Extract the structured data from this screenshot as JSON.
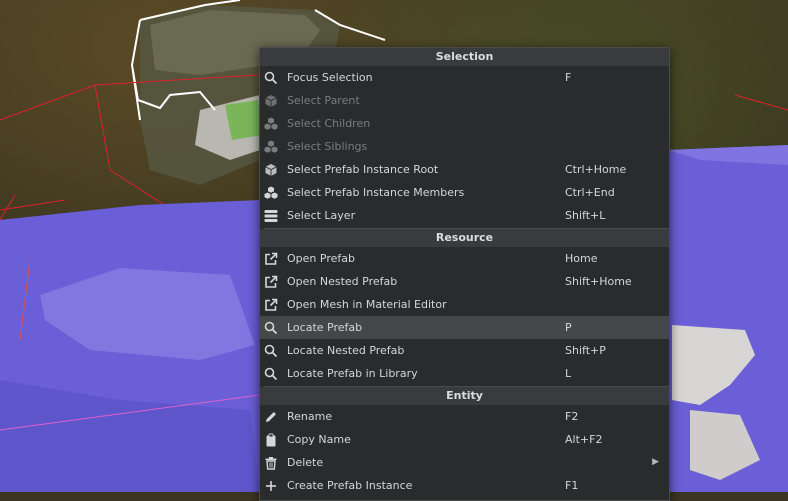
{
  "menu": {
    "sections": [
      {
        "header": "Selection",
        "items": [
          {
            "label": "Focus Selection",
            "shortcut": "F",
            "icon": "search-icon",
            "disabled": false
          },
          {
            "label": "Select Parent",
            "shortcut": "",
            "icon": "cube-icon",
            "disabled": true
          },
          {
            "label": "Select Children",
            "shortcut": "",
            "icon": "cubes-icon",
            "disabled": true
          },
          {
            "label": "Select Siblings",
            "shortcut": "",
            "icon": "cubes-icon",
            "disabled": true
          },
          {
            "label": "Select Prefab Instance Root",
            "shortcut": "Ctrl+Home",
            "icon": "cube-icon",
            "disabled": false
          },
          {
            "label": "Select Prefab Instance Members",
            "shortcut": "Ctrl+End",
            "icon": "cubes-icon",
            "disabled": false
          },
          {
            "label": "Select Layer",
            "shortcut": "Shift+L",
            "icon": "layers-icon",
            "disabled": false
          }
        ]
      },
      {
        "header": "Resource",
        "items": [
          {
            "label": "Open Prefab",
            "shortcut": "Home",
            "icon": "external-link-icon",
            "disabled": false
          },
          {
            "label": "Open Nested Prefab",
            "shortcut": "Shift+Home",
            "icon": "external-link-icon",
            "disabled": false
          },
          {
            "label": "Open Mesh in Material Editor",
            "shortcut": "",
            "icon": "external-link-icon",
            "disabled": false
          },
          {
            "label": "Locate Prefab",
            "shortcut": "P",
            "icon": "search-icon",
            "disabled": false,
            "highlighted": true
          },
          {
            "label": "Locate Nested Prefab",
            "shortcut": "Shift+P",
            "icon": "search-icon",
            "disabled": false
          },
          {
            "label": "Locate Prefab in Library",
            "shortcut": "L",
            "icon": "search-icon",
            "disabled": false
          }
        ]
      },
      {
        "header": "Entity",
        "items": [
          {
            "label": "Rename",
            "shortcut": "F2",
            "icon": "pencil-icon",
            "disabled": false
          },
          {
            "label": "Copy Name",
            "shortcut": "Alt+F2",
            "icon": "clipboard-icon",
            "disabled": false
          },
          {
            "label": "Delete",
            "shortcut": "",
            "icon": "trash-icon",
            "disabled": false,
            "submenu": true
          },
          {
            "label": "Create Prefab Instance",
            "shortcut": "F1",
            "icon": "plus-icon",
            "disabled": false
          }
        ]
      }
    ]
  },
  "colors": {
    "menu_bg": "#2a2b2d",
    "header_bg": "#3a3b3e",
    "highlight_bg": "#46474a",
    "mesh_overlay": "#6a5fd6",
    "selection_outline": "#ffffff",
    "bounds_lines": "#e0202a"
  }
}
